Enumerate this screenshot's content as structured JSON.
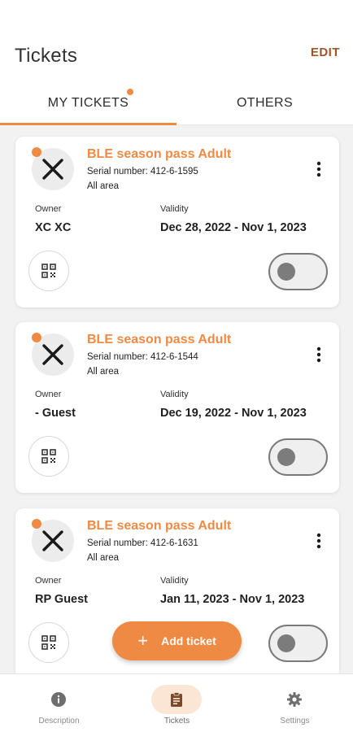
{
  "header": {
    "title": "Tickets",
    "edit_label": "EDIT"
  },
  "tabs": [
    {
      "label": "MY TICKETS",
      "active": true,
      "has_dot": true
    },
    {
      "label": "OTHERS",
      "active": false,
      "has_dot": false
    }
  ],
  "tickets": [
    {
      "name": "BLE season pass Adult",
      "serial": "Serial number: 412-6-1595",
      "area": "All area",
      "owner_label": "Owner",
      "owner": "XC XC",
      "validity_label": "Validity",
      "validity": "Dec 28, 2022 - Nov 1, 2023",
      "toggle_on": false
    },
    {
      "name": "BLE season pass Adult",
      "serial": "Serial number: 412-6-1544",
      "area": "All area",
      "owner_label": "Owner",
      "owner": "- Guest",
      "validity_label": "Validity",
      "validity": "Dec 19, 2022 - Nov 1, 2023",
      "toggle_on": false
    },
    {
      "name": "BLE season pass Adult",
      "serial": "Serial number: 412-6-1631",
      "area": "All area",
      "owner_label": "Owner",
      "owner": "RP Guest",
      "validity_label": "Validity",
      "validity": "Jan 11, 2023 - Nov 1, 2023",
      "toggle_on": false
    }
  ],
  "fab": {
    "icon": "plus-icon",
    "label": "Add ticket"
  },
  "bottom_nav": [
    {
      "label": "Description",
      "icon": "info-icon",
      "active": false
    },
    {
      "label": "Tickets",
      "icon": "clipboard-icon",
      "active": true
    },
    {
      "label": "Settings",
      "icon": "gear-icon",
      "active": false
    }
  ],
  "colors": {
    "accent": "#ef8a45",
    "edit": "#a0542c",
    "background": "#f2f2f2"
  }
}
